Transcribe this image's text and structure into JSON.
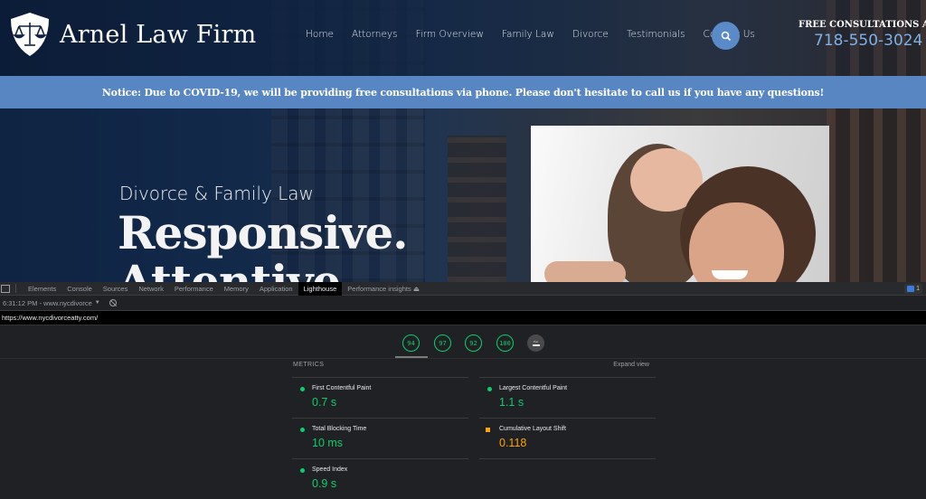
{
  "site": {
    "brand": "Arnel Law Firm",
    "nav": [
      "Home",
      "Attorneys",
      "Firm Overview",
      "Family Law",
      "Divorce",
      "Testimonials",
      "Contact Us"
    ],
    "search_icon": "search-icon",
    "consult_label": "FREE CONSULTATIONS AVAILAB",
    "phone": "718-550-3024",
    "notice": "Notice: Due to COVID-19, we will be providing free consultations via phone. Please don't hesitate to call us if you have any questions!",
    "hero_subtitle": "Divorce & Family Law",
    "hero_title": "Responsive.",
    "hero_title_2": "Attentive.",
    "colors": {
      "notice_bg": "#5786c3",
      "phone": "#7fb0e6",
      "search_bg": "#5b8ac9"
    }
  },
  "devtools": {
    "tabs": [
      "Elements",
      "Console",
      "Sources",
      "Network",
      "Performance",
      "Memory",
      "Application",
      "Lighthouse",
      "Performance insights"
    ],
    "active_tab": "Lighthouse",
    "issues_count": "1",
    "report_selector": "6:31:12 PM - www.nycdivorce",
    "url": "https://www.nycdivorceatty.com/",
    "scores": [
      {
        "category": "performance",
        "value": "94"
      },
      {
        "category": "accessibility",
        "value": "97"
      },
      {
        "category": "best-practices",
        "value": "92"
      },
      {
        "category": "seo",
        "value": "100"
      }
    ],
    "pwa_label": "PWA",
    "metrics_title": "METRICS",
    "expand_label": "Expand view",
    "metrics": [
      {
        "name": "First Contentful Paint",
        "value": "0.7 s",
        "status": "pass"
      },
      {
        "name": "Largest Contentful Paint",
        "value": "1.1 s",
        "status": "pass"
      },
      {
        "name": "Total Blocking Time",
        "value": "10 ms",
        "status": "pass"
      },
      {
        "name": "Cumulative Layout Shift",
        "value": "0.118",
        "status": "average"
      },
      {
        "name": "Speed Index",
        "value": "0.9 s",
        "status": "pass"
      }
    ],
    "colors": {
      "pass": "#0cce6b",
      "average": "#ffa400"
    }
  }
}
